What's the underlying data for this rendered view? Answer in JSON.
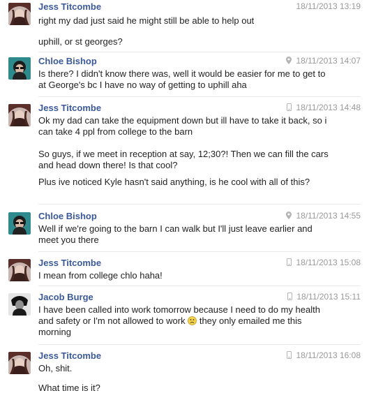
{
  "messages": [
    {
      "sender": "Jess Titcombe",
      "timestamp": "18/11/2013 13:19",
      "source_icon": "none",
      "paragraphs": [
        "right my dad just said he might still be able to help out",
        "uphill, or st georges?"
      ]
    },
    {
      "sender": "Chloe Bishop",
      "timestamp": "18/11/2013 14:07",
      "source_icon": "location-pin-icon",
      "paragraphs": [
        "Is there? I didn't know there was, well it would be easier for me to get to at George's bc I have no way of getting to uphill aha"
      ]
    },
    {
      "sender": "Jess Titcombe",
      "timestamp": "18/11/2013 14:48",
      "source_icon": "mobile-phone-icon",
      "paragraphs": [
        "Ok my dad can take the equipment down but ill have to take it back, so i can take 4 ppl from college to the barn",
        "So guys, if we meet in reception at say, 12;30?! Then we can fill the cars and head down there! Is that cool?",
        "Plus ive noticed Kyle hasn't said anything, is he cool with all of this?"
      ]
    },
    {
      "sender": "Chloe Bishop",
      "timestamp": "18/11/2013 14:55",
      "source_icon": "location-pin-icon",
      "paragraphs": [
        "Well if we're going to the barn I can walk but I'll just leave earlier and meet you there"
      ]
    },
    {
      "sender": "Jess Titcombe",
      "timestamp": "18/11/2013 15:08",
      "source_icon": "mobile-phone-icon",
      "paragraphs": [
        "I mean from college chlo haha!"
      ]
    },
    {
      "sender": "Jacob Burge",
      "timestamp": "18/11/2013 15:11",
      "source_icon": "mobile-phone-icon",
      "paragraphs": [
        "I have been called into work tomorrow because I need to do my health and safety or I'm not allowed to work",
        "they only emailed me this morning"
      ],
      "inline_icon": "frown-emoji-icon"
    },
    {
      "sender": "Jess Titcombe",
      "timestamp": "18/11/2013 16:08",
      "source_icon": "mobile-phone-icon",
      "paragraphs": [
        "Oh, shit.",
        "What time is it?"
      ]
    }
  ],
  "colors": {
    "sender_name": "#3b5998",
    "timestamp": "#999999",
    "text": "#1f1f1f",
    "divider": "#e9e9e9"
  }
}
